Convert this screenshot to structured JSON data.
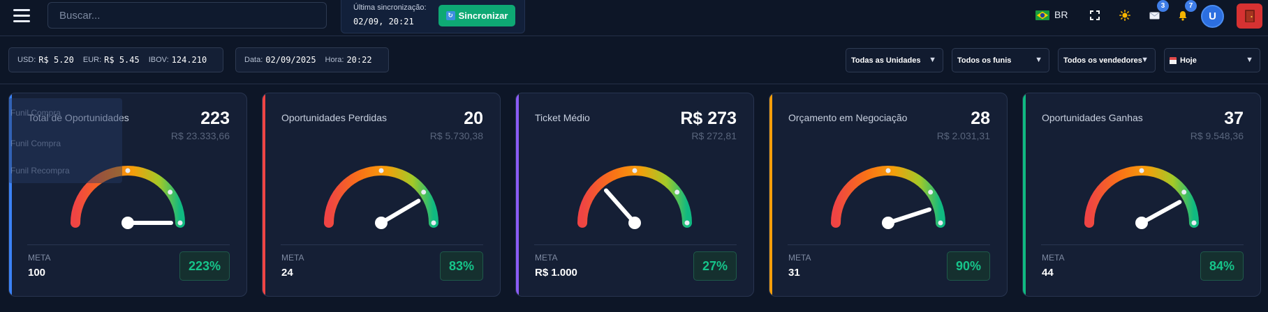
{
  "header": {
    "search_placeholder": "Buscar...",
    "sync": {
      "title": "Última sincronização:",
      "time": "02/09, 20:21",
      "button_label": "Sincronizar"
    },
    "language": "BR",
    "mail_badge": "3",
    "notifications_badge": "7",
    "avatar_initial": "U"
  },
  "market": {
    "usd_label": "USD:",
    "usd_value": "R$ 5.20",
    "eur_label": "EUR:",
    "eur_value": "R$ 5.45",
    "ibov_label": "IBOV:",
    "ibov_value": "124.210"
  },
  "datetime": {
    "date_label": "Data:",
    "date_value": "02/09/2025",
    "time_label": "Hora:",
    "time_value": "20:22"
  },
  "filters": {
    "units": "Todas as Unidades",
    "funnels": "Todos os funis",
    "sellers": "Todos os vendedores",
    "period": "Hoje"
  },
  "funnel_menu": {
    "items": [
      "Funil Compra",
      "Funil Compra",
      "Funil Recompra"
    ]
  },
  "cards": [
    {
      "title": "Total de Oportunidades",
      "value": "223",
      "subvalue": "R$ 23.333,66",
      "meta_label": "META",
      "meta_value": "100",
      "percent": "223%",
      "gauge_level": 1.0,
      "accent": "#3b82f6"
    },
    {
      "title": "Oportunidades Perdidas",
      "value": "20",
      "subvalue": "R$ 5.730,38",
      "meta_label": "META",
      "meta_value": "24",
      "percent": "83%",
      "gauge_level": 0.83,
      "accent": "#ef4444"
    },
    {
      "title": "Ticket Médio",
      "value": "R$ 273",
      "subvalue": "R$ 272,81",
      "meta_label": "META",
      "meta_value": "R$ 1.000",
      "percent": "27%",
      "gauge_level": 0.27,
      "accent": "#8b5cf6"
    },
    {
      "title": "Orçamento em Negociação",
      "value": "28",
      "subvalue": "R$ 2.031,31",
      "meta_label": "META",
      "meta_value": "31",
      "percent": "90%",
      "gauge_level": 0.9,
      "accent": "#f59e0b"
    },
    {
      "title": "Oportunidades Ganhas",
      "value": "37",
      "subvalue": "R$ 9.548,36",
      "meta_label": "META",
      "meta_value": "44",
      "percent": "84%",
      "gauge_level": 0.84,
      "accent": "#10b981"
    }
  ],
  "colors": {
    "background": "#0d1627",
    "card": "#151f35",
    "success": "#16c48a",
    "sync_button": "#0ea974",
    "exit_button": "#d63232"
  }
}
